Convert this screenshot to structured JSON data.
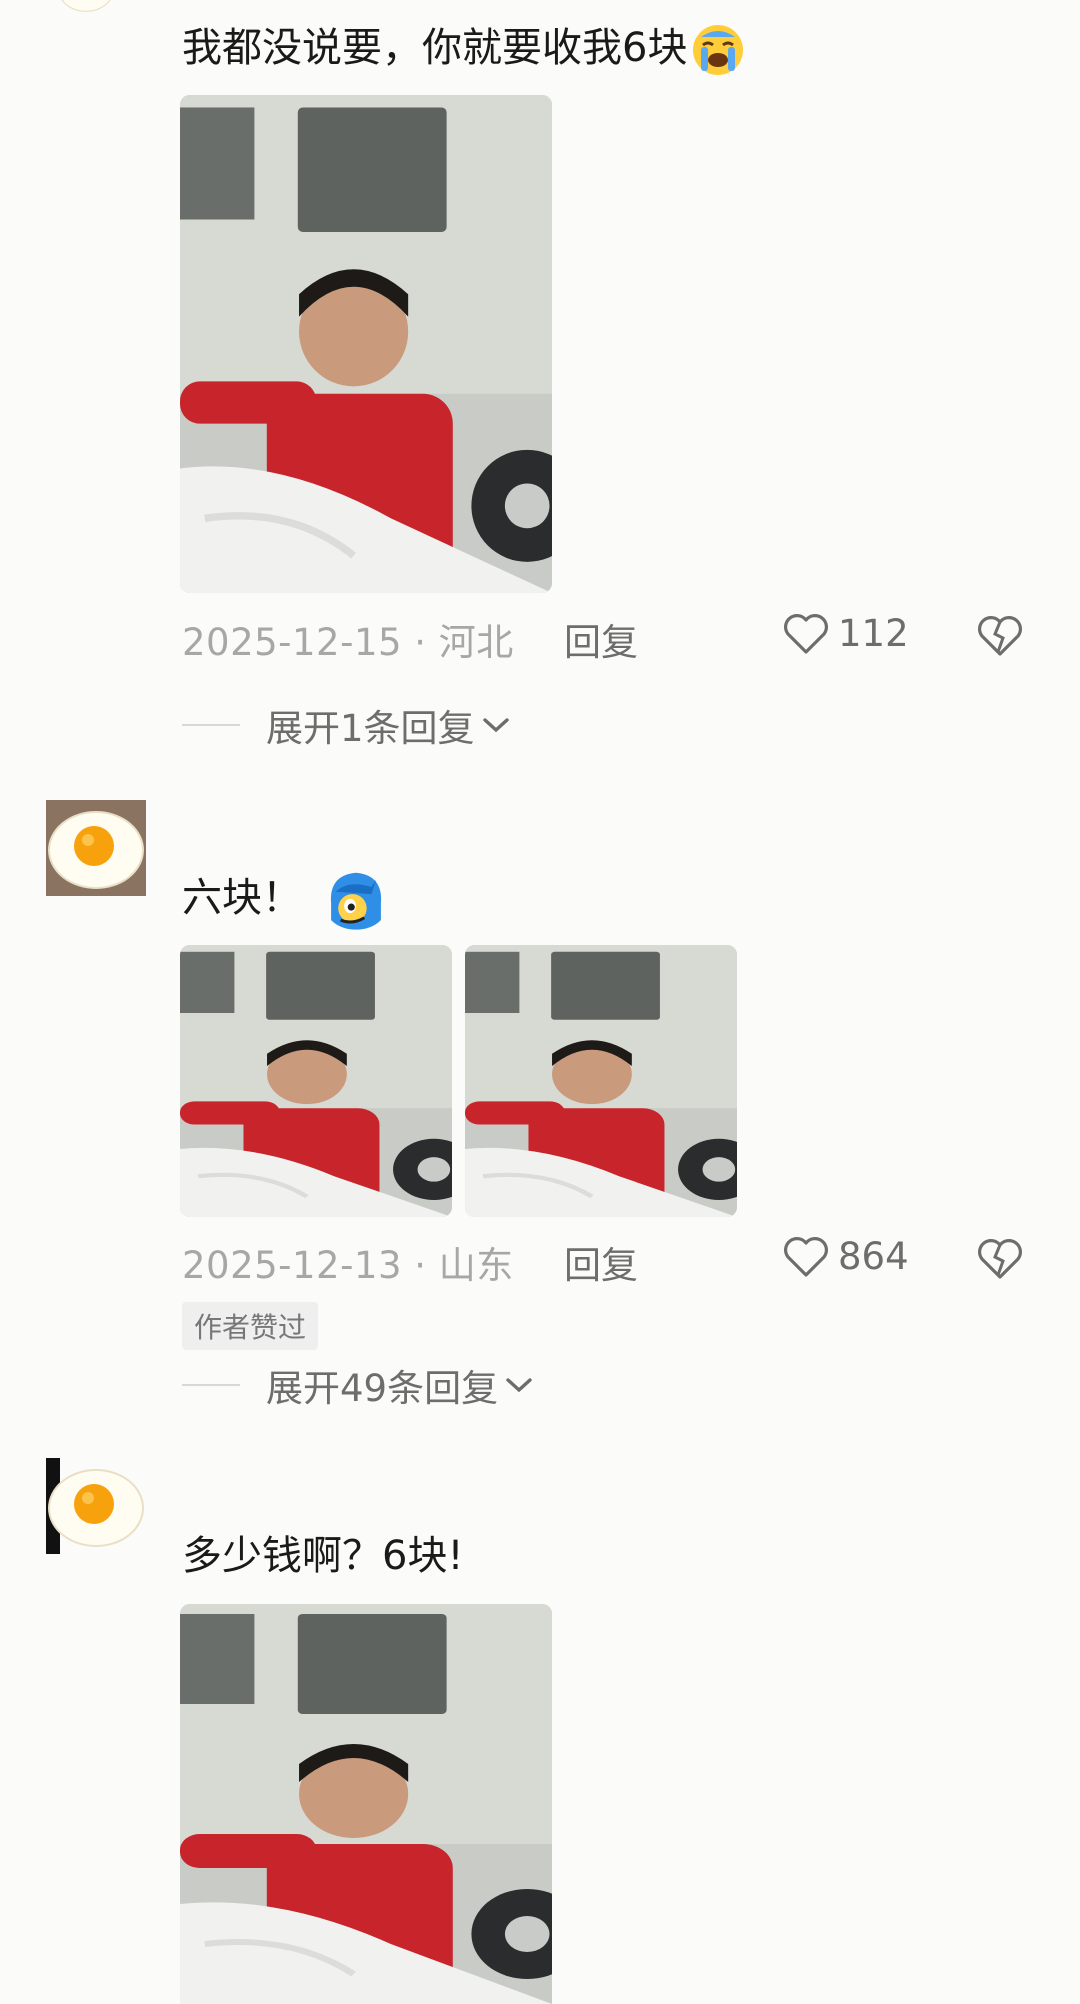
{
  "comments": [
    {
      "text": "我都没说要，你就要收我6块",
      "emoji_icon": "loudly-crying-face-icon",
      "date_location": "2025-12-15 · 河北",
      "reply_label": "回复",
      "likes": "112",
      "expand_label": "展开1条回复"
    },
    {
      "text": "六块！",
      "emoji_icon": "blue-hair-character-emoji-icon",
      "date_location": "2025-12-13 · 山东",
      "reply_label": "回复",
      "likes": "864",
      "badge": "作者赞过",
      "expand_label": "展开49条回复"
    },
    {
      "text": "多少钱啊？6块!"
    }
  ],
  "icons": {
    "avatar": "fried-egg-avatar",
    "like": "heart-outline-icon",
    "dislike": "broken-heart-icon",
    "expand": "chevron-down-icon"
  },
  "colors": {
    "background": "#fbfbf9",
    "meta_text": "#a7a7a7",
    "action_text": "#6d6d6d"
  }
}
